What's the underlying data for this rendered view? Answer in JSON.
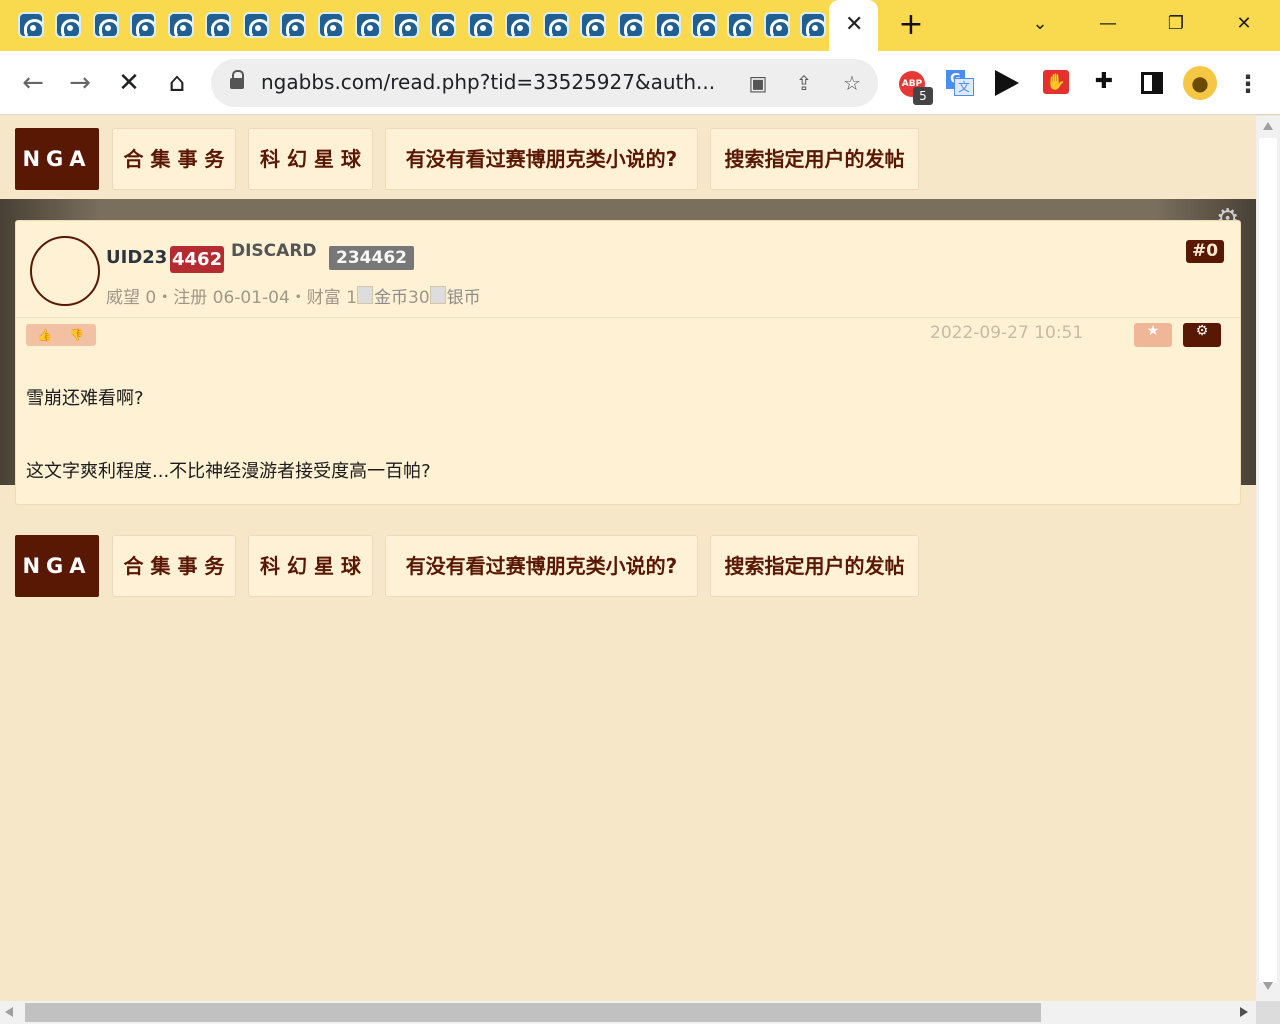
{
  "browser": {
    "tab_count": 22,
    "active_tab_close": "✕",
    "new_tab": "+",
    "window_controls": [
      "⌄",
      "—",
      "❐",
      "✕"
    ],
    "url": "ngabbs.com/read.php?tid=33525927&auth...",
    "extensions": {
      "adblock_label": "ABP",
      "adblock_count": "5"
    }
  },
  "page": {
    "nav": {
      "logo": "NGA",
      "items": [
        "合 集 事 务",
        "科 幻 星 球",
        "有没有看过赛博朋克类小说的?",
        "搜索指定用户的发帖"
      ]
    },
    "post": {
      "username_prefix": "UID23",
      "username_highlight": "4462",
      "discard": "DISCARD",
      "uid_badge": "234462",
      "meta_prefix": "威望 0・注册 06-01-04・财富 1",
      "coin_gold": "金币",
      "coin_mid": "30",
      "coin_silver": "银币",
      "floor": "#0",
      "time": "2022-09-27 10:51",
      "content_line1": "雪崩还难看啊?",
      "content_line2": "这文字爽利程度...不比神经漫游者接受度高一百帕?"
    }
  },
  "colors": {
    "nav_logo": "#591804",
    "page_bg": "#f6e7c9",
    "post_bg": "#fff2d4",
    "uid_red": "#b52c30"
  }
}
